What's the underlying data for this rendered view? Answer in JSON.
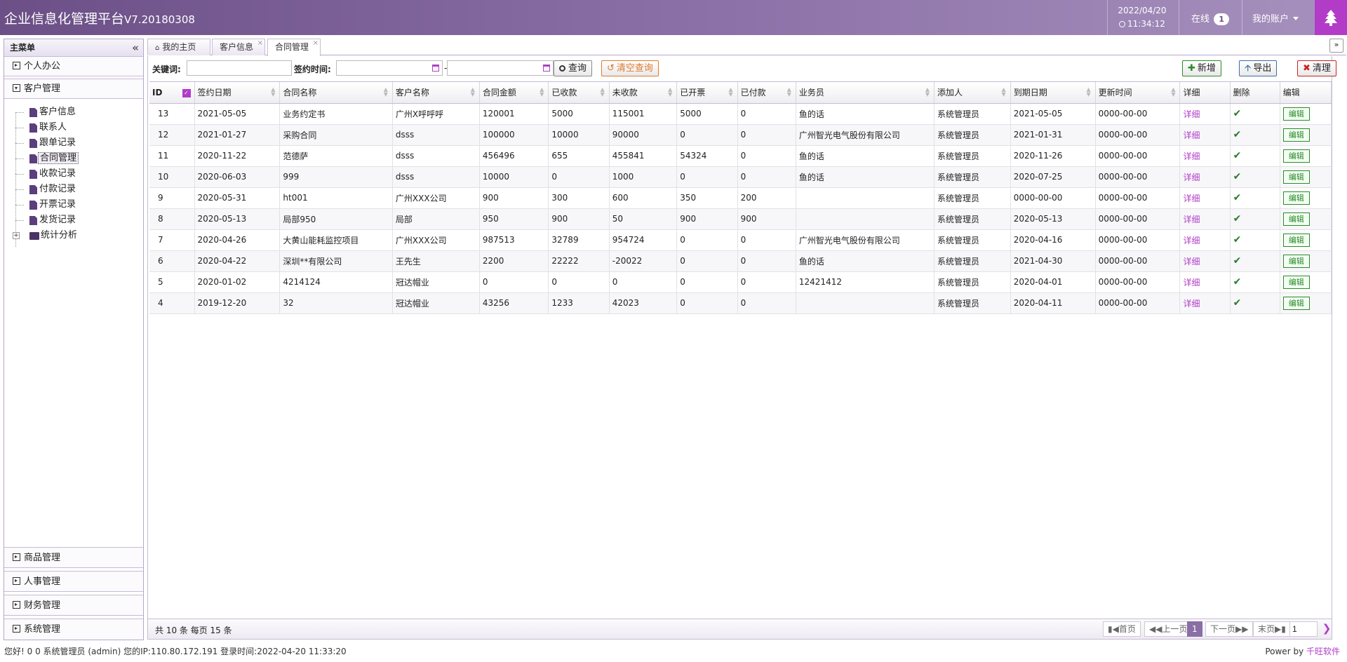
{
  "header": {
    "title": "企业信息化管理平台",
    "version": "V7.20180308",
    "date": "2022/04/20",
    "time": "11:34:12",
    "online_label": "在线",
    "online_count": "1",
    "account_label": "我的账户"
  },
  "sidebar": {
    "title": "主菜单",
    "sections": [
      {
        "label": "个人办公"
      },
      {
        "label": "客户管理"
      }
    ],
    "tree": [
      {
        "label": "客户信息"
      },
      {
        "label": "联系人"
      },
      {
        "label": "跟单记录"
      },
      {
        "label": "合同管理"
      },
      {
        "label": "收款记录"
      },
      {
        "label": "付款记录"
      },
      {
        "label": "开票记录"
      },
      {
        "label": "发货记录"
      },
      {
        "label": "统计分析"
      }
    ],
    "bottom_sections": [
      {
        "label": "商品管理"
      },
      {
        "label": "人事管理"
      },
      {
        "label": "财务管理"
      },
      {
        "label": "系统管理"
      }
    ]
  },
  "tabs": [
    {
      "label": "我的主页"
    },
    {
      "label": "客户信息"
    },
    {
      "label": "合同管理"
    }
  ],
  "toolbar": {
    "keyword_label": "关键词:",
    "keyword_value": "",
    "date_label": "签约时间:",
    "date_sep": "-",
    "search_label": "查询",
    "clear_label": "清空查询",
    "add_label": "新增",
    "export_label": "导出",
    "purge_label": "清理"
  },
  "table": {
    "columns": [
      "ID",
      "签约日期",
      "合同名称",
      "客户名称",
      "合同金额",
      "已收款",
      "未收款",
      "已开票",
      "已付款",
      "业务员",
      "添加人",
      "到期日期",
      "更新时间",
      "详细",
      "删除",
      "编辑"
    ],
    "rows": [
      [
        "13",
        "2021-05-05",
        "业务约定书",
        "广州X呼呼呼",
        "120001",
        "5000",
        "115001",
        "5000",
        "0",
        "鱼的话",
        "系统管理员",
        "2021-05-05",
        "0000-00-00"
      ],
      [
        "12",
        "2021-01-27",
        "采购合同",
        "dsss",
        "100000",
        "10000",
        "90000",
        "0",
        "0",
        "广州智光电气股份有限公司",
        "系统管理员",
        "2021-01-31",
        "0000-00-00"
      ],
      [
        "11",
        "2020-11-22",
        "范德萨",
        "dsss",
        "456496",
        "655",
        "455841",
        "54324",
        "0",
        "鱼的话",
        "系统管理员",
        "2020-11-26",
        "0000-00-00"
      ],
      [
        "10",
        "2020-06-03",
        "999",
        "dsss",
        "10000",
        "0",
        "1000",
        "0",
        "0",
        "鱼的话",
        "系统管理员",
        "2020-07-25",
        "0000-00-00"
      ],
      [
        "9",
        "2020-05-31",
        "ht001",
        "广州XXX公司",
        "900",
        "300",
        "600",
        "350",
        "200",
        "",
        "系统管理员",
        "0000-00-00",
        "0000-00-00"
      ],
      [
        "8",
        "2020-05-13",
        "局部950",
        "局部",
        "950",
        "900",
        "50",
        "900",
        "900",
        "",
        "系统管理员",
        "2020-05-13",
        "0000-00-00"
      ],
      [
        "7",
        "2020-04-26",
        "大黄山能耗监控项目",
        "广州XXX公司",
        "987513",
        "32789",
        "954724",
        "0",
        "0",
        "广州智光电气股份有限公司",
        "系统管理员",
        "2020-04-16",
        "0000-00-00"
      ],
      [
        "6",
        "2020-04-22",
        "深圳**有限公司",
        "王先生",
        "2200",
        "22222",
        "-20022",
        "0",
        "0",
        "鱼的话",
        "系统管理员",
        "2021-04-30",
        "0000-00-00"
      ],
      [
        "5",
        "2020-01-02",
        "4214124",
        "冠达帽业",
        "0",
        "0",
        "0",
        "0",
        "0",
        "12421412",
        "系统管理员",
        "2020-04-01",
        "0000-00-00"
      ],
      [
        "4",
        "2019-12-20",
        "32",
        "冠达帽业",
        "43256",
        "1233",
        "42023",
        "0",
        "0",
        "",
        "系统管理员",
        "2020-04-11",
        "0000-00-00"
      ]
    ],
    "detail_label": "详细",
    "edit_label": "编辑"
  },
  "pager": {
    "info": "共 10 条 每页 15 条",
    "first": "首页",
    "prev": "上一页",
    "current": "1",
    "next": "下一页",
    "last": "末页",
    "goto_value": "1"
  },
  "footer": {
    "status": "您好! 0 0 系统管理员 (admin) 您的IP:110.80.172.191 登录时间:2022-04-20 11:33:20",
    "powered_prefix": "Power by ",
    "powered_link": "千旺软件"
  },
  "colors": {
    "brand": "#8a6ea6",
    "accent": "#b23cc8"
  }
}
